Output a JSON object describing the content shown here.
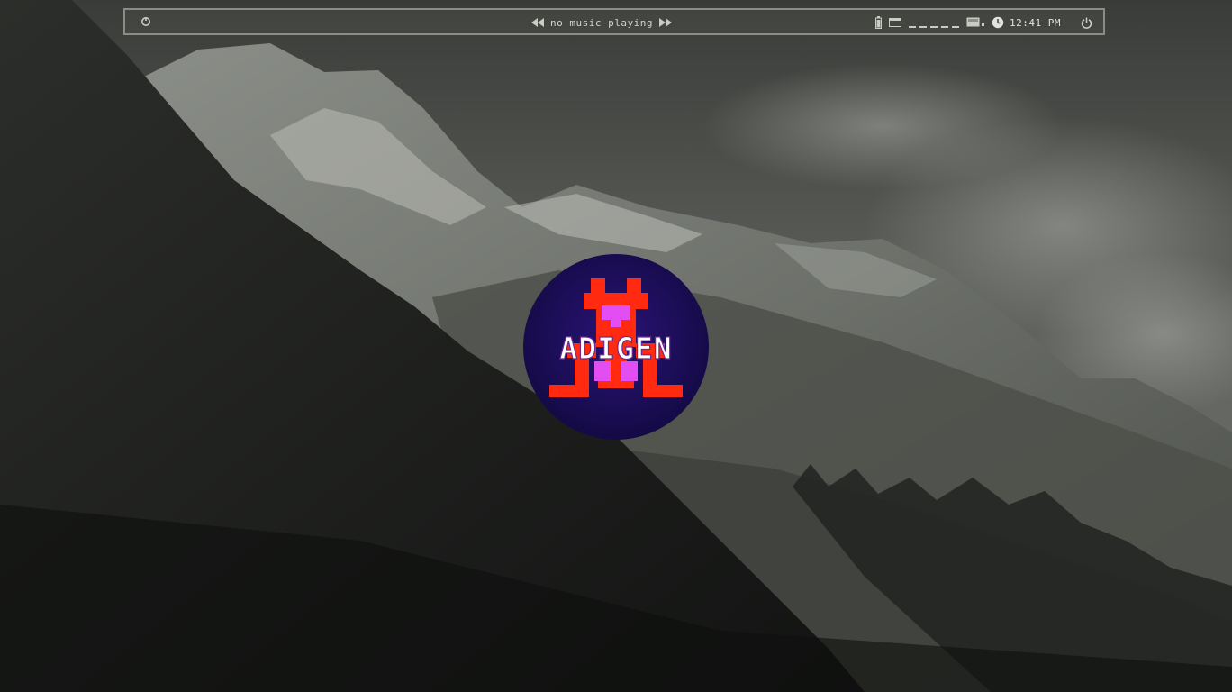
{
  "desktop": {
    "wallpaper_description": "",
    "logo": {
      "text": "ADIGEN",
      "colors": {
        "circle": "#1c0f5c",
        "glyph_red": "#ff2a10",
        "glyph_pink": "#e34ef2",
        "text": "#ffffff"
      }
    }
  },
  "topbar": {
    "menu_icon": "app-menu-icon",
    "media": {
      "prev_icon": "rewind-icon",
      "next_icon": "fast-forward-icon",
      "now_playing": "no music playing"
    },
    "tray": {
      "battery_icon": "battery-icon",
      "window_icon": "window-icon",
      "workspaces": 5,
      "display_icon": "display-icon",
      "clock_icon": "clock-icon",
      "time": "12:41 PM",
      "power_icon": "power-icon"
    },
    "colors": {
      "border": "#8a8c87",
      "text": "#d8d9d4"
    }
  }
}
